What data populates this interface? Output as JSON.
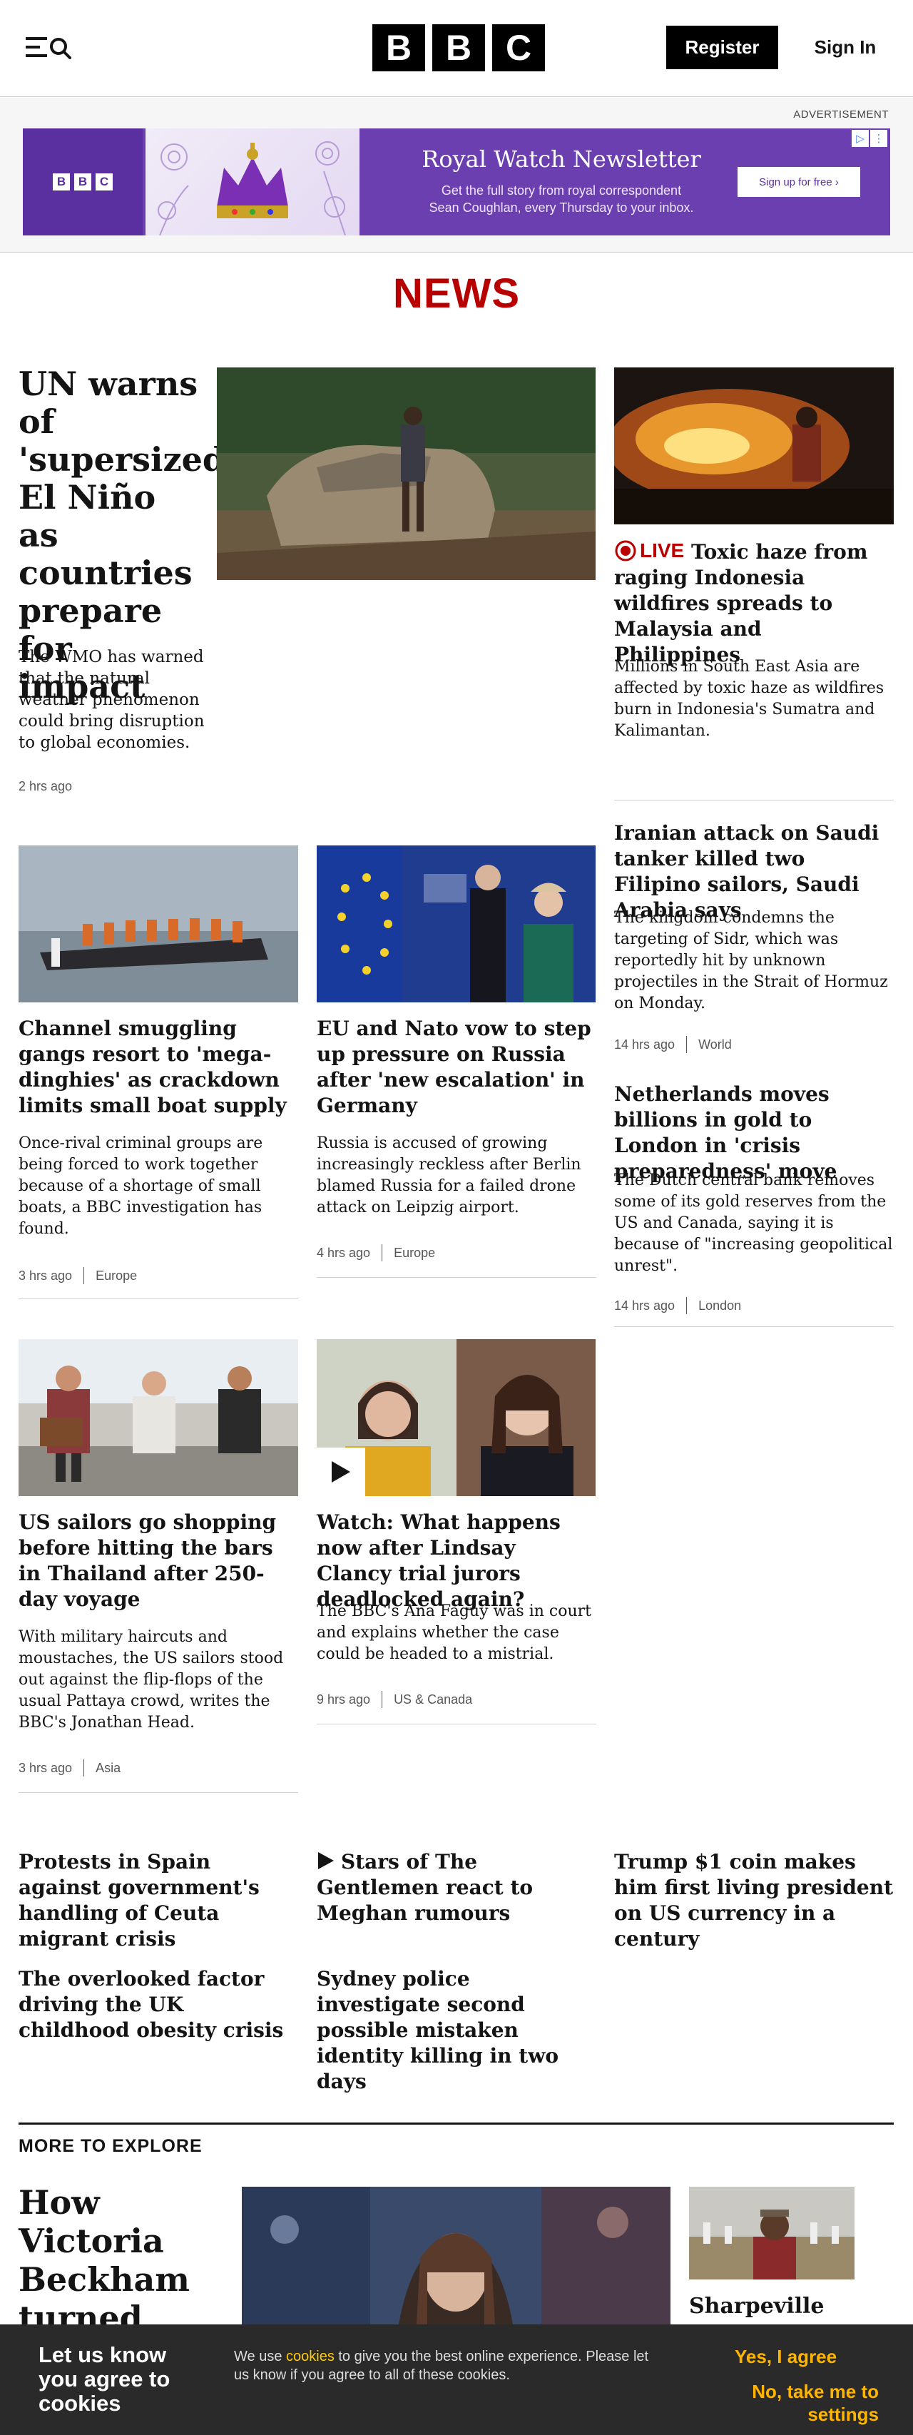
{
  "header": {
    "logo_letters": [
      "B",
      "B",
      "C"
    ],
    "register_label": "Register",
    "signin_label": "Sign In"
  },
  "ad": {
    "label": "ADVERTISEMENT",
    "logo_letters": [
      "B",
      "B",
      "C"
    ],
    "title": "Royal Watch Newsletter",
    "subtitle_line1": "Get the full story from royal correspondent",
    "subtitle_line2": "Sean Coughlan, every Thursday to your inbox.",
    "cta": "Sign up for free ›"
  },
  "section_title": "NEWS",
  "live_label": "LIVE",
  "articles": {
    "un": {
      "headline": "UN warns of 'supersized' El Niño as countries prepare for impact",
      "summary": "The WMO has warned that the natural weather phenomenon could bring disruption to global economies.",
      "time": "2 hrs ago"
    },
    "haze": {
      "headline": "Toxic haze from raging Indonesia wildfires spreads to Malaysia and Philippines",
      "summary": "Millions in South East Asia are affected by toxic haze as wildfires burn in Indonesia's Sumatra and Kalimantan."
    },
    "iran": {
      "headline": "Iranian attack on Saudi tanker killed two Filipino sailors, Saudi Arabia says",
      "summary": "The kingdom condemns the targeting of Sidr, which was reportedly hit by unknown projectiles in the Strait of Hormuz on Monday.",
      "time": "14 hrs ago",
      "tag": "World"
    },
    "channel": {
      "headline": "Channel smuggling gangs resort to 'mega-dinghies' as crackdown limits small boat supply",
      "summary": "Once-rival criminal groups are being forced to work together because of a shortage of small boats, a BBC investigation has found.",
      "time": "3 hrs ago",
      "tag": "Europe"
    },
    "eu": {
      "headline": "EU and Nato vow to step up pressure on Russia after 'new escalation' in Germany",
      "summary": "Russia is accused of growing increasingly reckless after Berlin blamed Russia for a failed drone attack on Leipzig airport.",
      "time": "4 hrs ago",
      "tag": "Europe"
    },
    "gold": {
      "headline": "Netherlands moves billions in gold to London in 'crisis preparedness' move",
      "summary": "The Dutch central bank removes some of its gold reserves from the US and Canada, saying it is because of \"increasing geopolitical unrest\".",
      "time": "14 hrs ago",
      "tag": "London"
    },
    "sailors": {
      "headline": "US sailors go shopping before hitting the bars in Thailand after 250-day voyage",
      "summary": "With military haircuts and moustaches, the US sailors stood out against the flip-flops of the usual Pattaya crowd, writes the BBC's Jonathan Head.",
      "time": "3 hrs ago",
      "tag": "Asia"
    },
    "clancy": {
      "headline": "Watch: What happens now after Lindsay Clancy trial jurors deadlocked again?",
      "summary": "The BBC's Ana Faguy was in court and explains whether the case could be headed to a mistrial.",
      "time": "9 hrs ago",
      "tag": "US & Canada"
    }
  },
  "small_headlines": {
    "spain": "Protests in Spain against government's handling of Ceuta migrant crisis",
    "gentlemen": "Stars of The Gentlemen react to Meghan rumours",
    "trump": "Trump $1 coin makes him first living president on US currency in a century",
    "obesity": "The overlooked factor driving the UK childhood obesity crisis",
    "sydney": "Sydney police investigate second possible mistaken identity killing in two days"
  },
  "more": {
    "title": "MORE TO EXPLORE",
    "beckham_headline": "How Victoria Beckham turned her",
    "sharpeville": "Sharpeville"
  },
  "cookie": {
    "title": "Let us know you agree to cookies",
    "text_before": "We use ",
    "link": "cookies",
    "text_after": " to give you the best online experience. Please let us know if you agree to all of these cookies.",
    "yes": "Yes, I agree",
    "no": "No, take me to settings"
  },
  "colors": {
    "brand_red": "#b80000",
    "ad_purple": "#6b3fb0",
    "cookie_accent": "#ffb400"
  }
}
